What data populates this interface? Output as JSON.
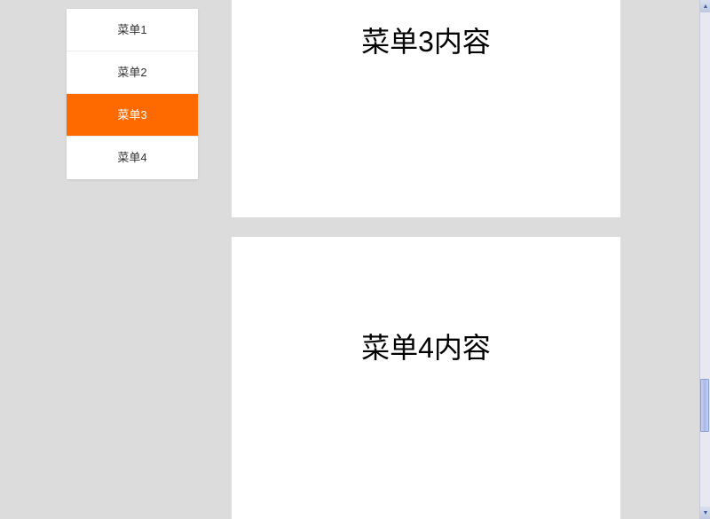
{
  "sidebar": {
    "items": [
      {
        "label": "菜单1",
        "active": false
      },
      {
        "label": "菜单2",
        "active": false
      },
      {
        "label": "菜单3",
        "active": true
      },
      {
        "label": "菜单4",
        "active": false
      }
    ]
  },
  "content": {
    "panels": [
      {
        "title": "菜单3内容"
      },
      {
        "title": "菜单4内容"
      }
    ]
  },
  "colors": {
    "accent": "#ff6a00",
    "pageBg": "#dcdcdc",
    "panelBg": "#ffffff"
  }
}
